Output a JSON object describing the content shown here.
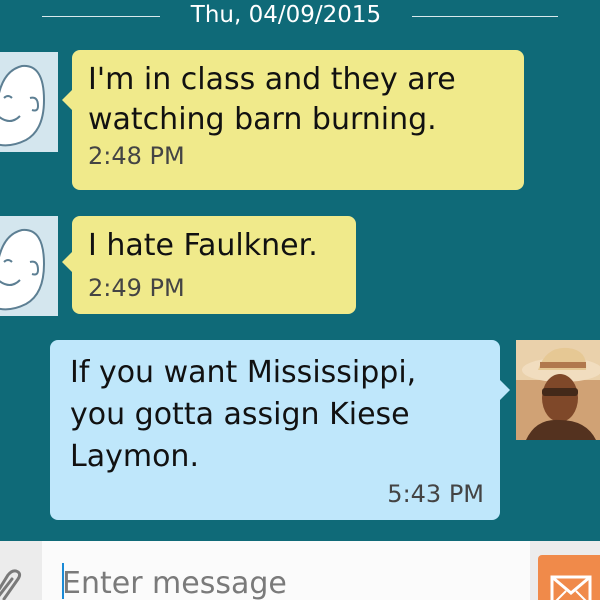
{
  "conversation": {
    "date_divider": "Thu, 04/09/2015"
  },
  "messages": [
    {
      "direction": "incoming",
      "text": "I'm in class and they are\nwatching barn burning.",
      "time": "2:48 PM",
      "avatar": "default-person-icon"
    },
    {
      "direction": "incoming",
      "text": "I hate Faulkner.",
      "time": "2:49 PM",
      "avatar": "default-person-icon"
    },
    {
      "direction": "outgoing",
      "text": "If you want Mississippi,\nyou gotta assign Kiese\nLaymon.",
      "time": "5:43 PM",
      "avatar": "user-photo"
    }
  ],
  "composer": {
    "placeholder": "Enter message",
    "attach_icon": "paperclip-icon",
    "send_icon": "send-envelope-icon"
  },
  "colors": {
    "background": "#0f6a78",
    "incoming_bubble": "#f0ea8b",
    "outgoing_bubble": "#bfe7fb",
    "send_button": "#f08a4a"
  }
}
